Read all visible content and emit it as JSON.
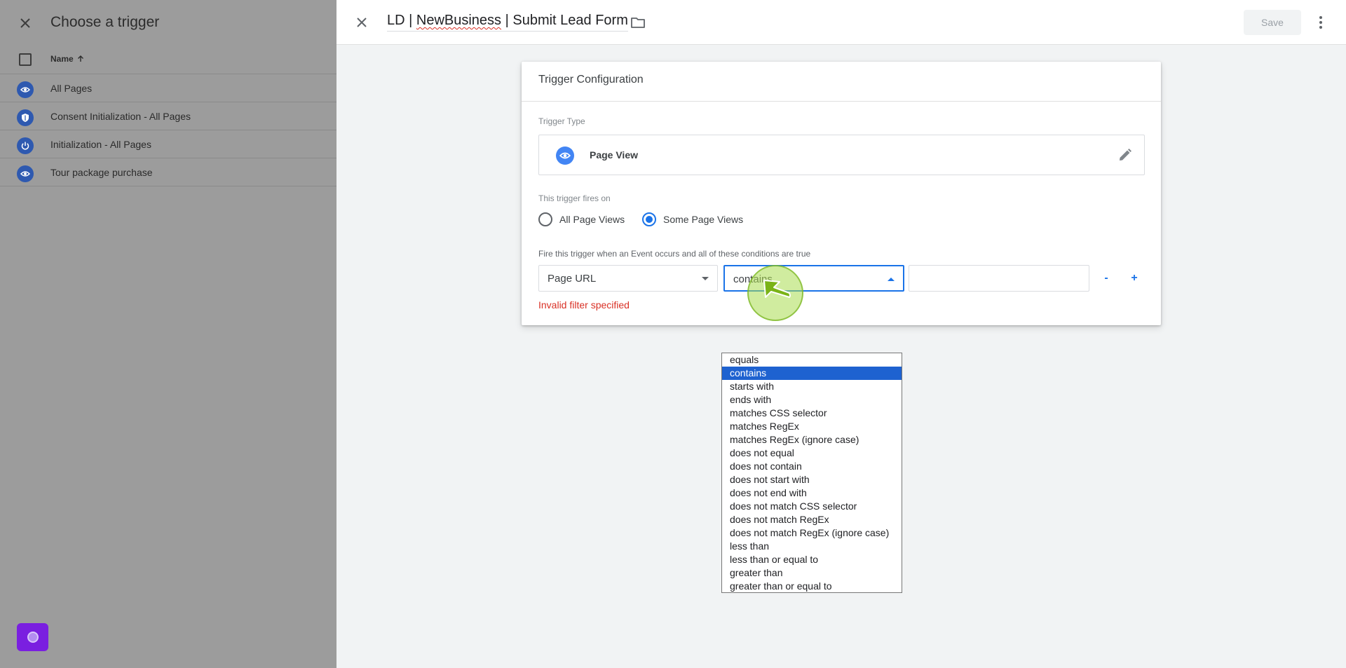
{
  "left": {
    "title": "Choose a trigger",
    "column_name": "Name",
    "triggers": [
      {
        "label": "All Pages",
        "icon": "eye-icon"
      },
      {
        "label": "Consent Initialization - All Pages",
        "icon": "shield-icon"
      },
      {
        "label": "Initialization - All Pages",
        "icon": "power-icon"
      },
      {
        "label": "Tour package purchase",
        "icon": "eye-icon"
      }
    ]
  },
  "editor": {
    "tag_name_prefix": "LD | ",
    "tag_name_spell": "NewBusiness",
    "tag_name_suffix": " | Submit Lead Form",
    "save_label": "Save"
  },
  "card": {
    "title": "Trigger Configuration",
    "type_label": "Trigger Type",
    "type_name": "Page View",
    "fires_label": "This trigger fires on",
    "radio_all": "All Page Views",
    "radio_some": "Some Page Views",
    "selected_radio": "some",
    "condition_label": "Fire this trigger when an Event occurs and all of these conditions are true",
    "variable_value": "Page URL",
    "operator_value": "contains",
    "value_input": "",
    "minus_label": "-",
    "plus_label": "+",
    "error": "Invalid filter specified"
  },
  "operator_options": [
    "equals",
    "contains",
    "starts with",
    "ends with",
    "matches CSS selector",
    "matches RegEx",
    "matches RegEx (ignore case)",
    "does not equal",
    "does not contain",
    "does not start with",
    "does not end with",
    "does not match CSS selector",
    "does not match RegEx",
    "does not match RegEx (ignore case)",
    "less than",
    "less than or equal to",
    "greater than",
    "greater than or equal to"
  ],
  "selected_operator_index": 1,
  "colors": {
    "accent": "#1a73e8",
    "error": "#d93025",
    "list_selected": "#1e62d0",
    "left_icon": "#2e59b0",
    "fab": "#7a1fe0"
  }
}
